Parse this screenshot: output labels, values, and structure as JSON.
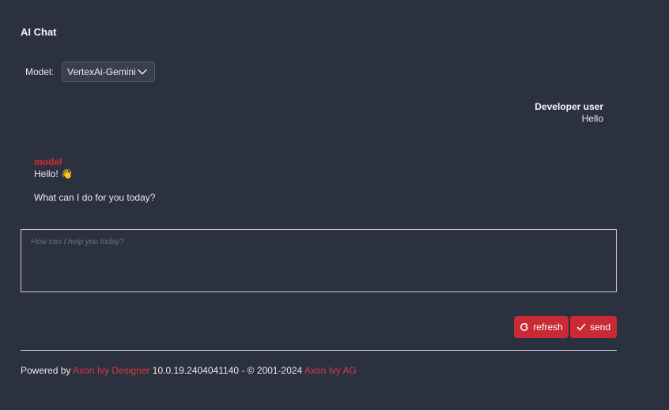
{
  "page": {
    "title": "AI Chat"
  },
  "model_selector": {
    "label": "Model:",
    "selected": "VertexAi-Gemini",
    "icon": "chevron-down-icon"
  },
  "messages": {
    "user": {
      "sender": "Developer user",
      "text": "Hello"
    },
    "model": {
      "sender": "model",
      "lines": [
        "Hello! 👋",
        "What can I do for you today?"
      ]
    }
  },
  "chat_input": {
    "placeholder": "How can I help you today?",
    "value": ""
  },
  "actions": {
    "refresh_label": "refresh",
    "refresh_icon": "refresh-icon",
    "send_label": "send",
    "send_icon": "check-icon"
  },
  "footer": {
    "powered_by": "Powered by",
    "product_link": "Axon Ivy Designer",
    "version": "10.0.19.2404041140 - © 2001-2024",
    "company_link": "Axon Ivy AG"
  },
  "colors": {
    "background": "#2c3140",
    "accent": "#c92a33",
    "model_name": "#e0282f",
    "link": "#d83a40"
  }
}
